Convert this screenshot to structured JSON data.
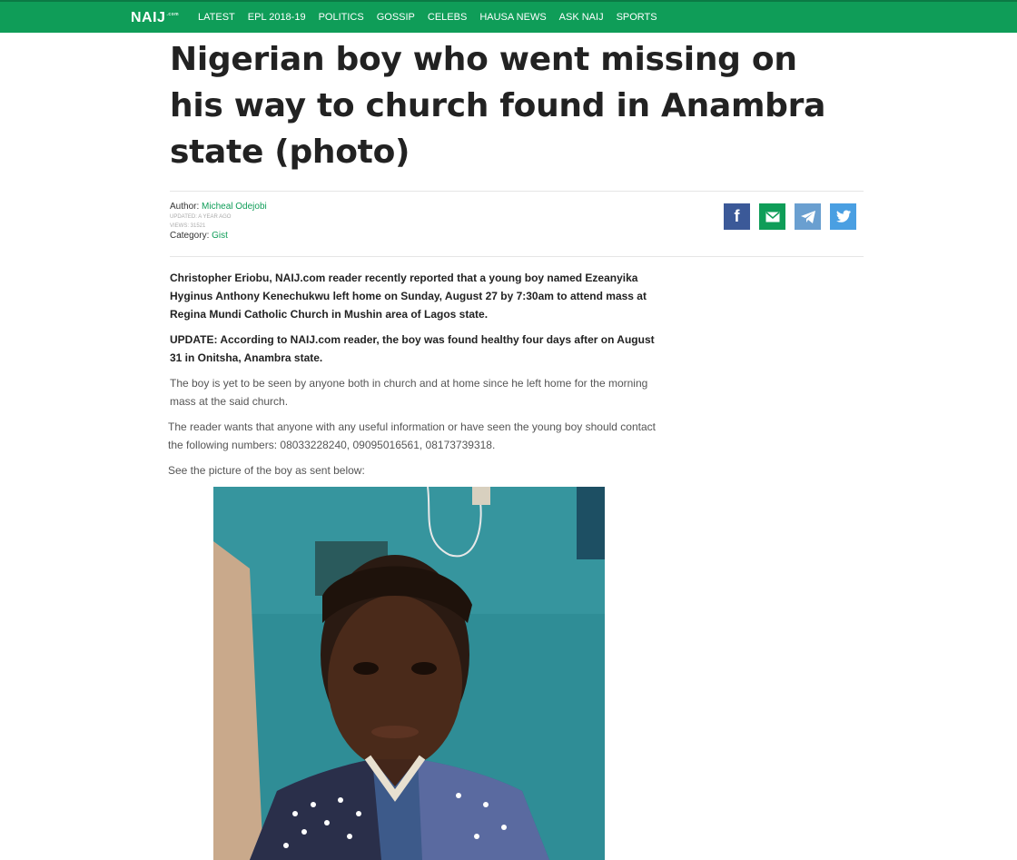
{
  "nav": {
    "logo": "NAIJ",
    "logo_sub": ".com",
    "items": [
      "LATEST",
      "EPL 2018-19",
      "POLITICS",
      "GOSSIP",
      "CELEBS",
      "HAUSA NEWS",
      "ASK NAIJ",
      "SPORTS"
    ]
  },
  "article": {
    "title": "Nigerian boy who went missing on his way to church found in Anambra state (photo)",
    "author_label": "Author:",
    "author_name": "Micheal Odejobi",
    "updated": "UPDATED: A YEAR AGO",
    "views": "VIEWS: 31521",
    "category_label": "Category:",
    "category": "Gist",
    "paragraphs": [
      "Christopher Eriobu, NAIJ.com reader recently reported that a young boy named Ezeanyika Hyginus Anthony Kenechukwu left home on Sunday, August 27 by 7:30am to attend mass at Regina Mundi Catholic Church in Mushin area of Lagos state.",
      "UPDATE: According to NAIJ.com reader, the boy was found healthy four days after on August 31 in Onitsha, Anambra state.",
      "The boy is yet to be seen by anyone both in church and at home since he left home for the morning mass at the said church.",
      "The reader wants that anyone with any useful information or have seen the young boy should contact the following numbers: 08033228240, 09095016561, 08173739318.",
      "See the picture of the boy as sent below:"
    ]
  },
  "share": {
    "icons": [
      "facebook-icon",
      "email-icon",
      "telegram-icon",
      "twitter-icon"
    ]
  },
  "colors": {
    "brand_green": "#0f9d58",
    "facebook": "#3b5998",
    "telegram": "#6a9fd0",
    "twitter": "#4a9fe2"
  }
}
